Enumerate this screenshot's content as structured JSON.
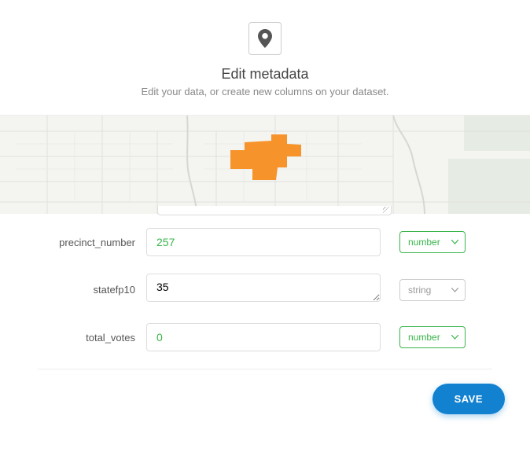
{
  "header": {
    "title": "Edit metadata",
    "subtitle": "Edit your data, or create new columns on your dataset."
  },
  "fields": [
    {
      "label": "precinct_number",
      "value": "257",
      "type": "number",
      "value_style": "green",
      "type_style": "green",
      "multiline": false
    },
    {
      "label": "statefp10",
      "value": "35",
      "type": "string",
      "value_style": "plain",
      "type_style": "gray",
      "multiline": true
    },
    {
      "label": "total_votes",
      "value": "0",
      "type": "number",
      "value_style": "green",
      "type_style": "green",
      "multiline": false
    }
  ],
  "footer": {
    "save_label": "SAVE"
  }
}
